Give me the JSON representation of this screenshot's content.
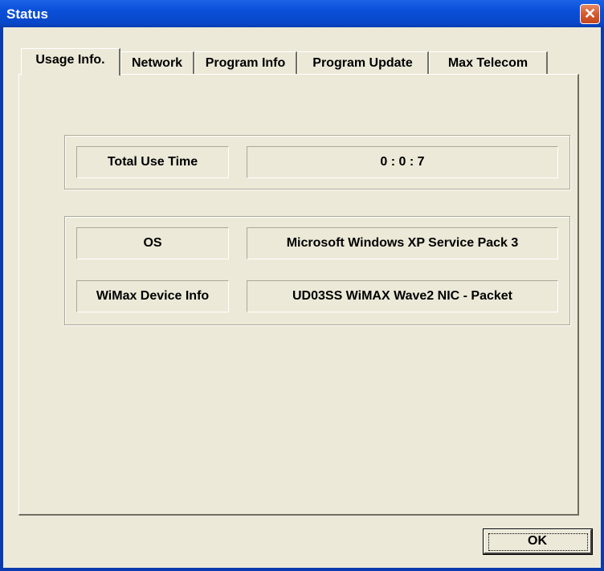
{
  "window": {
    "title": "Status",
    "close_icon": "close-icon"
  },
  "tabs": [
    {
      "label": "Usage Info.",
      "active": true
    },
    {
      "label": "Network",
      "active": false
    },
    {
      "label": "Program Info",
      "active": false
    },
    {
      "label": "Program Update",
      "active": false
    },
    {
      "label": "Max Telecom",
      "active": false
    }
  ],
  "usage": {
    "total_use_time_label": "Total Use Time",
    "total_use_time_value": "0 : 0 : 7"
  },
  "device": {
    "os_label": "OS",
    "os_value": "Microsoft Windows XP Service Pack 3",
    "wimax_label": "WiMax Device Info",
    "wimax_value": "UD03SS WiMAX Wave2 NIC - Packet"
  },
  "footer": {
    "ok_label": "OK"
  }
}
